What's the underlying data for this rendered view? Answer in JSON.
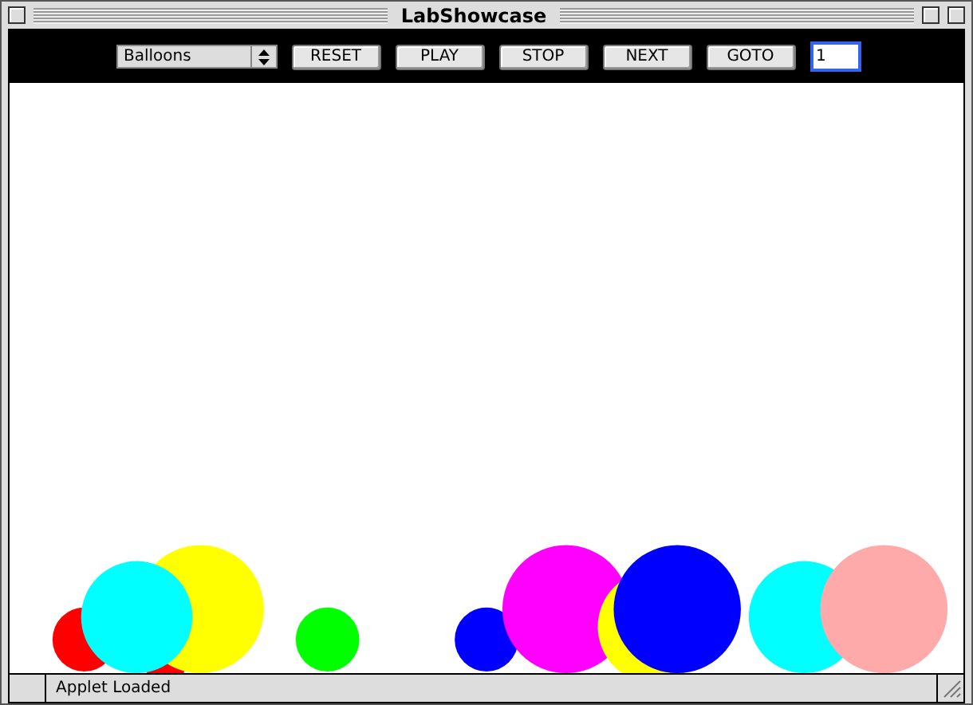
{
  "window": {
    "title": "LabShowcase"
  },
  "toolbar": {
    "demo_select": {
      "value": "Balloons"
    },
    "buttons": [
      "RESET",
      "PLAY",
      "STOP",
      "NEXT",
      "GOTO"
    ],
    "goto_field": {
      "value": "1",
      "focused": true
    }
  },
  "status_bar": {
    "text": "Applet Loaded"
  }
}
